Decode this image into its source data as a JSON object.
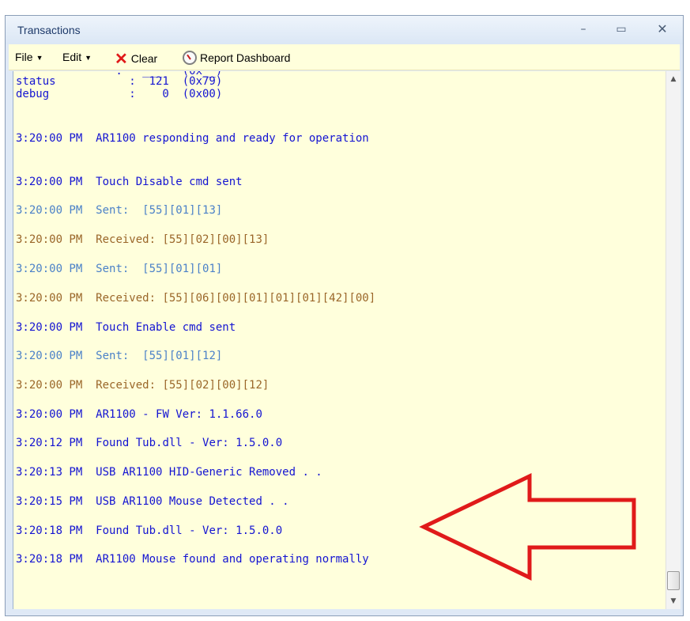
{
  "window": {
    "title": "Transactions",
    "min_icon": "minimize-icon",
    "max_icon": "maximize-icon",
    "close_icon": "close-icon"
  },
  "toolbar": {
    "file_label": "File",
    "edit_label": "Edit",
    "clear_label": "Clear",
    "report_label": "Report Dashboard",
    "dropdown_icon": "chevron-down-icon",
    "clear_icon": "red-x-icon",
    "report_icon": "gauge-icon"
  },
  "log": {
    "partial_line": "               :   ___   (0x__)",
    "status_line": "status           :  121  (0x79)",
    "debug_line": "debug            :    0  (0x00)",
    "entries": [
      {
        "time": "3:20:00 PM",
        "text": "AR1100 responding and ready for operation",
        "kind": "info"
      },
      {
        "time": "3:20:00 PM",
        "text": "Touch Disable cmd sent",
        "kind": "info"
      },
      {
        "time": "3:20:00 PM",
        "text": "Sent:  [55][01][13]",
        "kind": "sent"
      },
      {
        "time": "3:20:00 PM",
        "text": "Received: [55][02][00][13]",
        "kind": "recv"
      },
      {
        "time": "3:20:00 PM",
        "text": "Sent:  [55][01][01]",
        "kind": "sent"
      },
      {
        "time": "3:20:00 PM",
        "text": "Received: [55][06][00][01][01][01][42][00]",
        "kind": "recv"
      },
      {
        "time": "3:20:00 PM",
        "text": "Touch Enable cmd sent",
        "kind": "info"
      },
      {
        "time": "3:20:00 PM",
        "text": "Sent:  [55][01][12]",
        "kind": "sent"
      },
      {
        "time": "3:20:00 PM",
        "text": "Received: [55][02][00][12]",
        "kind": "recv"
      },
      {
        "time": "3:20:00 PM",
        "text": "AR1100 - FW Ver: 1.1.66.0",
        "kind": "info"
      },
      {
        "time": "3:20:12 PM",
        "text": "Found Tub.dll - Ver: 1.5.0.0",
        "kind": "info"
      },
      {
        "time": "3:20:13 PM",
        "text": "USB AR1100 HID-Generic Removed . .",
        "kind": "info"
      },
      {
        "time": "3:20:15 PM",
        "text": "USB AR1100 Mouse Detected . .",
        "kind": "info"
      },
      {
        "time": "3:20:18 PM",
        "text": "Found Tub.dll - Ver: 1.5.0.0",
        "kind": "info"
      },
      {
        "time": "3:20:18 PM",
        "text": "AR1100 Mouse found and operating normally",
        "kind": "info"
      }
    ]
  },
  "colors": {
    "log_info": "#1414d2",
    "log_sent": "#4b81c8",
    "log_received": "#9a6629",
    "background": "#ffffdc",
    "annotation_arrow": "#e01a1a"
  },
  "annotation": {
    "icon": "red-arrow-left-icon"
  }
}
